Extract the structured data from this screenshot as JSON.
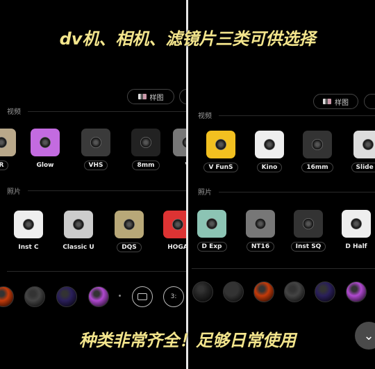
{
  "captions": {
    "top": "dv机、相机、滤镜片三类可供选择",
    "bottom": "种类非常齐全！足够日常使用"
  },
  "left": {
    "sample_button": "样图",
    "video_section": "视频",
    "photo_section": "照片",
    "video_items": [
      {
        "label": "R",
        "color": "#b9a88a"
      },
      {
        "label": "Glow",
        "color": "#c36be0"
      },
      {
        "label": "VHS",
        "color": "#3a3a3a"
      },
      {
        "label": "8mm",
        "color": "#222"
      },
      {
        "label": "V",
        "color": "#777"
      }
    ],
    "photo_items": [
      {
        "label": "Inst C",
        "color": "#eee"
      },
      {
        "label": "Classic U",
        "color": "#ccc"
      },
      {
        "label": "DQS",
        "color": "#b8a878"
      },
      {
        "label": "HOGA",
        "color": "#d33"
      }
    ],
    "aspect_button": "",
    "ratio_button": "3:"
  },
  "right": {
    "sample_button": "样图",
    "video_section": "视频",
    "photo_section": "照片",
    "video_items": [
      {
        "label": "V FunS",
        "color": "#f2c020"
      },
      {
        "label": "Kino",
        "color": "#eee"
      },
      {
        "label": "16mm",
        "color": "#333"
      },
      {
        "label": "Slide P",
        "color": "#ddd"
      }
    ],
    "photo_items": [
      {
        "label": "D Exp",
        "color": "#8cc4b4"
      },
      {
        "label": "NT16",
        "color": "#777"
      },
      {
        "label": "Inst SQ",
        "color": "#333"
      },
      {
        "label": "D Half",
        "color": "#eee"
      }
    ]
  },
  "lens_colors": {
    "left": [
      "#c33a0a",
      "#444",
      "#2a1f5a",
      "#b049d0"
    ],
    "right": [
      "#222",
      "#333",
      "#c33a0a",
      "#444",
      "#2a1f5a",
      "#b049d0"
    ]
  }
}
